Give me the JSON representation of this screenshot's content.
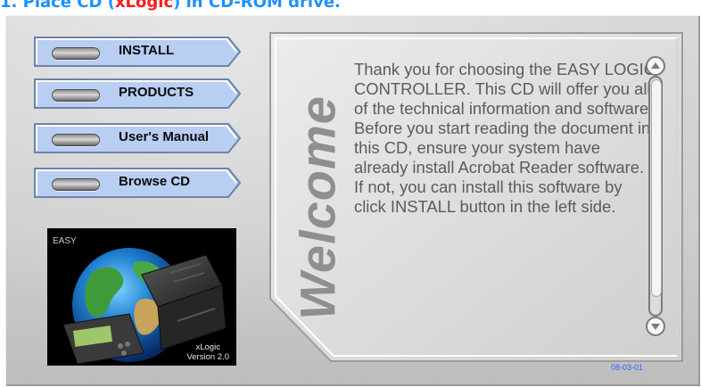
{
  "heading": {
    "prefix": "1. Place CD (",
    "brand": "xLogic",
    "suffix": ") in CD-ROM drive."
  },
  "menu": {
    "buttons": [
      {
        "label": "INSTALL"
      },
      {
        "label": "PRODUCTS"
      },
      {
        "label": "User's Manual"
      },
      {
        "label": "Browse CD"
      }
    ]
  },
  "logo": {
    "corner_text": "EASY",
    "product_name": "xLogic",
    "version": "Version 2.0"
  },
  "welcome": {
    "title": "Welcome",
    "paragraphs": [
      "Thank you for choosing the EASY LOGIC CONTROLLER. This CD will offer you all of the technical information and software.",
      "Before you start reading the document in this CD,  ensure your system have already install Acrobat Reader software. If not, you can install this software by click INSTALL button in the left side."
    ]
  },
  "scrollbar": {
    "up_icon": "arrow-up-circle-icon",
    "down_icon": "arrow-down-circle-icon"
  },
  "footer": {
    "date": "08-03-01"
  },
  "colors": {
    "heading_blue": "#1e90ff",
    "brand_red": "#ff1a1a",
    "button_fill": "#b9cef3",
    "date_blue": "#2e60ff",
    "welcome_gray": "#8f8f8f"
  }
}
